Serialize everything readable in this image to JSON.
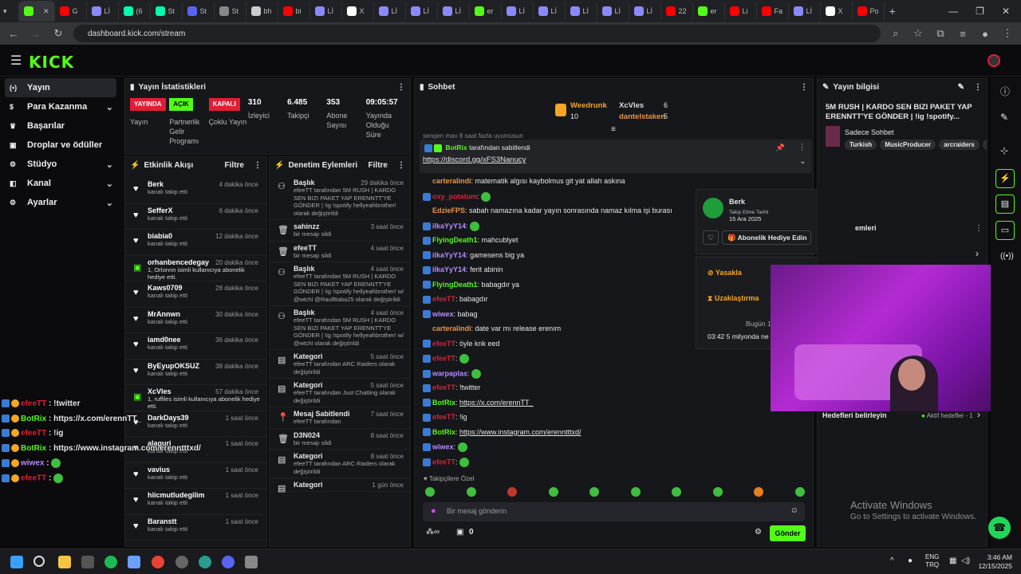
{
  "browser": {
    "tabs": [
      {
        "label": "",
        "color": "#53fc18",
        "active": true
      },
      {
        "label": "G",
        "color": "#ff0000"
      },
      {
        "label": "Lİ",
        "color": "#8a8aff"
      },
      {
        "label": "(6",
        "color": "#0fa"
      },
      {
        "label": "St",
        "color": "#0fa"
      },
      {
        "label": "St",
        "color": "#5865f2"
      },
      {
        "label": "St",
        "color": "#888"
      },
      {
        "label": "bh",
        "color": "#ccc"
      },
      {
        "label": "bi",
        "color": "#ff0000"
      },
      {
        "label": "Lİ",
        "color": "#8a8aff"
      },
      {
        "label": "X",
        "color": "#fff"
      },
      {
        "label": "Lİ",
        "color": "#8a8aff"
      },
      {
        "label": "Lİ",
        "color": "#8a8aff"
      },
      {
        "label": "Lİ",
        "color": "#8a8aff"
      },
      {
        "label": "er",
        "color": "#53fc18"
      },
      {
        "label": "Lİ",
        "color": "#8a8aff"
      },
      {
        "label": "Lİ",
        "color": "#8a8aff"
      },
      {
        "label": "Lİ",
        "color": "#8a8aff"
      },
      {
        "label": "Lİ",
        "color": "#8a8aff"
      },
      {
        "label": "Lİ",
        "color": "#8a8aff"
      },
      {
        "label": "22",
        "color": "#ff0000"
      },
      {
        "label": "er",
        "color": "#53fc18"
      },
      {
        "label": "Li",
        "color": "#ff0000"
      },
      {
        "label": "Fa",
        "color": "#ff0000"
      },
      {
        "label": "Lİ",
        "color": "#8a8aff"
      },
      {
        "label": "X",
        "color": "#fff"
      },
      {
        "label": "Po",
        "color": "#ff0000"
      }
    ],
    "url": "dashboard.kick.com/stream"
  },
  "kick": {
    "logo": "KICK"
  },
  "sidebar": {
    "items": [
      {
        "label": "Yayın",
        "icon": "broadcast-icon",
        "active": true
      },
      {
        "label": "Para Kazanma",
        "icon": "dollar-icon",
        "chev": true
      },
      {
        "label": "Başarılar",
        "icon": "trophy-icon"
      },
      {
        "label": "Droplar ve ödüller",
        "icon": "gift-icon"
      },
      {
        "label": "Stüdyo",
        "icon": "studio-icon",
        "chev": true
      },
      {
        "label": "Kanal",
        "icon": "channel-icon",
        "chev": true
      },
      {
        "label": "Ayarlar",
        "icon": "gear-icon",
        "chev": true
      }
    ]
  },
  "stats": {
    "title": "Yayın İstatistikleri",
    "items": [
      {
        "badge": "YAYINDA",
        "badge_bg": "#e01e37",
        "badge_fg": "#fff",
        "label": "Yayın"
      },
      {
        "badge": "AÇIK",
        "badge_bg": "#53fc18",
        "badge_fg": "#000",
        "label": "Partnerlik Gelir Programı"
      },
      {
        "badge": "KAPALI",
        "badge_bg": "#e01e37",
        "badge_fg": "#fff",
        "label": "Çoklu Yayın"
      },
      {
        "value": "310",
        "label": "İzleyici"
      },
      {
        "value": "6.485",
        "label": "Takipçi"
      },
      {
        "value": "353",
        "label": "Abone Sayısı"
      },
      {
        "value": "09:05:57",
        "label": "Yayında Olduğu Süre"
      }
    ]
  },
  "activity": {
    "title": "Etkinlik Akışı",
    "filter": "Filtre",
    "rows": [
      {
        "name": "Berk",
        "time": "4 dakika önce",
        "sub": "kanalı takip etti",
        "icon": "heart-icon"
      },
      {
        "name": "SefferX",
        "time": "6 dakika önce",
        "sub": "kanalı takip etti",
        "icon": "heart-icon"
      },
      {
        "name": "biabia0",
        "time": "12 dakika önce",
        "sub": "kanalı takip etti",
        "icon": "heart-icon"
      },
      {
        "name": "orhanbencedegay",
        "time": "20 dakika önce",
        "sub": "1, Orİonnn isimli kullanıcıya abonelik hediye etti.",
        "icon": "gift-icon"
      },
      {
        "name": "Kaws0709",
        "time": "28 dakika önce",
        "sub": "kanalı takip etti",
        "icon": "heart-icon"
      },
      {
        "name": "MrAnnwn",
        "time": "30 dakika önce",
        "sub": "kanalı takip etti",
        "icon": "heart-icon"
      },
      {
        "name": "iamd0nee",
        "time": "36 dakika önce",
        "sub": "kanalı takip etti",
        "icon": "heart-icon"
      },
      {
        "name": "ByEyupOKSUZ",
        "time": "38 dakika önce",
        "sub": "kanalı takip etti",
        "icon": "heart-icon"
      },
      {
        "name": "XcVles",
        "time": "57 dakika önce",
        "sub": "1, ruffiles isimli kullanıcıya abonelik hediye etti.",
        "icon": "gift-icon"
      },
      {
        "name": "DarkDays39",
        "time": "1 saat önce",
        "sub": "kanalı takip etti",
        "icon": "heart-icon"
      },
      {
        "name": "alaguri",
        "time": "1 saat önce",
        "sub": "kanalı takip etti",
        "icon": "heart-icon"
      },
      {
        "name": "vavius",
        "time": "1 saat önce",
        "sub": "kanalı takip etti",
        "icon": "heart-icon"
      },
      {
        "name": "hiicmutludegilim",
        "time": "1 saat önce",
        "sub": "kanalı takip etti",
        "icon": "heart-icon"
      },
      {
        "name": "Baranstt",
        "time": "1 saat önce",
        "sub": "kanalı takip etti",
        "icon": "heart-icon"
      }
    ]
  },
  "moderation": {
    "title": "Denetim Eylemleri",
    "filter": "Filtre",
    "rows": [
      {
        "name": "Başlık",
        "time": "29 dakika önce",
        "sub": "efeeTT tarafından 5M RUSH | KARDO SEN BIZI PAKET YAP ERENNTT'YE GÖNDER | !ig !spotify hellyeahbrother! olarak değiştirildi",
        "icon": "users-icon"
      },
      {
        "name": "sahinzz",
        "time": "3 saat önce",
        "sub": "bir mesajı sildi",
        "icon": "trash-icon"
      },
      {
        "name": "efeeTT",
        "time": "4 saat önce",
        "sub": "bir mesajı sildi",
        "icon": "trash-icon"
      },
      {
        "name": "Başlık",
        "time": "4 saat önce",
        "sub": "efeeTT tarafından 5M RUSH | KARDO SEN BIZI PAKET YAP ERENNTT'YE GÖNDER | !ig !spotify hellyeahbrother! w/ @wtcN @RaufBaba25 olarak değiştirildi",
        "icon": "users-icon"
      },
      {
        "name": "Başlık",
        "time": "4 saat önce",
        "sub": "efeeTT tarafından 5M RUSH | KARDO SEN BIZI PAKET YAP ERENNTT'YE GÖNDER | !ig !spotify hellyeahbrother! w/ @wtcN olarak değiştirildi",
        "icon": "users-icon"
      },
      {
        "name": "Kategori",
        "time": "5 saat önce",
        "sub": "efeeTT tarafından ARC Raiders olarak değiştirildi",
        "icon": "category-icon"
      },
      {
        "name": "Kategori",
        "time": "5 saat önce",
        "sub": "efeeTT tarafından Just Chatting olarak değiştirildi",
        "icon": "category-icon"
      },
      {
        "name": "Mesaj Sabitlendi",
        "time": "7 saat önce",
        "sub": "efeeTT tarafından",
        "icon": "pin-icon"
      },
      {
        "name": "D3N024",
        "time": "8 saat önce",
        "sub": "bir mesajı sildi",
        "icon": "trash-icon"
      },
      {
        "name": "Kategori",
        "time": "8 saat önce",
        "sub": "efeeTT tarafından ARC Raiders olarak değiştirildi",
        "icon": "category-icon"
      },
      {
        "name": "Kategori",
        "time": "1 gün önce",
        "sub": "",
        "icon": "category-icon"
      }
    ]
  },
  "chat": {
    "title": "Sohbet",
    "leaders": [
      {
        "name": "Weedrunk",
        "count": "10",
        "color": "#f5a623"
      },
      {
        "name": "XcVles",
        "count": "6",
        "color": "#ddd"
      },
      {
        "name": "dantelstaken",
        "count": "5",
        "color": "#e8954a"
      }
    ],
    "clipped": "sengen max 8 saat fazla uyumusun",
    "pinned": {
      "by": "BotRix",
      "suffix": "tarafından sabitlendi",
      "link": "https://discord.gg/xFS3Nanucy"
    },
    "messages": [
      {
        "user": "carteralindi",
        "color": "#e8954a",
        "text": "matematik algısı kaybolmus git yat allah askına"
      },
      {
        "user": "oxy_potatum",
        "color": "#e01e37",
        "text": ""
      },
      {
        "user": "EdzieFPS",
        "color": "#e8954a",
        "text": "sabah namazına kadar yayın sonrasında namaz kılma işi burası"
      },
      {
        "user": "ilkaYyY14",
        "color": "#b58cff",
        "text": ""
      },
      {
        "user": "FlyingDeath1",
        "color": "#53fc18",
        "text": "mahcublyet"
      },
      {
        "user": "ilkaYyY14",
        "color": "#b58cff",
        "text": "gamesens big ya"
      },
      {
        "user": "ilkaYyY14",
        "color": "#b58cff",
        "text": "ferit abinin"
      },
      {
        "user": "FlyingDeath1",
        "color": "#53fc18",
        "text": "babagdır ya"
      },
      {
        "user": "efeeTT",
        "color": "#e01e37",
        "text": "babagdır"
      },
      {
        "user": "wiwex",
        "color": "#b58cff",
        "text": "babag"
      },
      {
        "user": "carteralindi",
        "color": "#e8954a",
        "text": "date var mı release erenım"
      },
      {
        "user": "efeeTT",
        "color": "#e01e37",
        "text": "öyle knk eed"
      },
      {
        "user": "efeeTT",
        "color": "#e01e37",
        "text": ""
      },
      {
        "user": "warpaplas",
        "color": "#b58cff",
        "text": ""
      },
      {
        "user": "efeeTT",
        "color": "#e01e37",
        "text": "!twitter"
      },
      {
        "user": "BotRix",
        "color": "#53fc18",
        "text": "https://x.com/erennTT_"
      },
      {
        "user": "efeeTT",
        "color": "#e01e37",
        "text": "!ig"
      },
      {
        "user": "BotRix",
        "color": "#53fc18",
        "text": "https://www.instagram.com/erenntttxd/"
      },
      {
        "user": "wiwex",
        "color": "#b58cff",
        "text": ""
      },
      {
        "user": "efeeTT",
        "color": "#e01e37",
        "text": ""
      }
    ],
    "followers_only": "Takipçilere Özel",
    "input_placeholder": "Bir mesaj gönderin",
    "kicks": "0",
    "send": "Gönder"
  },
  "popup": {
    "name": "Berk",
    "follow_label": "Takip Etme Tarihi",
    "follow_date": "15 Ara 2025",
    "gift_btn": "Abonelik Hediye Edin",
    "ban": "Yasakla",
    "timeout": "Uzaklaştırma",
    "today": "Bugün 1",
    "partial": "03:42  5 milyonda ne"
  },
  "streaminfo": {
    "title": "Yayın bilgisi",
    "stream_title": "5M RUSH | KARDO SEN BIZI PAKET YAP ERENNTT'YE GÖNDER | !ig !spotify...",
    "category": "Sadece Sohbet",
    "tags": [
      "Turkish",
      "MusicProducer",
      "arcraiders",
      "cs"
    ],
    "partial_section": "emleri",
    "goals": "Hedefleri belirleyin",
    "active_goals": "Aktif hedefler - 1"
  },
  "overlay": [
    {
      "user": "efeeTT",
      "color": "#e01e37",
      "text": "!twitter"
    },
    {
      "user": "BotRix",
      "color": "#53fc18",
      "text": "https://x.com/erennTT_"
    },
    {
      "user": "efeeTT",
      "color": "#e01e37",
      "text": "!ig"
    },
    {
      "user": "BotRix",
      "color": "#53fc18",
      "text": "https://www.instagram.com/erenntttxd/"
    },
    {
      "user": "wiwex",
      "color": "#b58cff",
      "text": ""
    },
    {
      "user": "efeeTT",
      "color": "#e01e37",
      "text": ""
    }
  ],
  "watermark": {
    "line1": "Activate Windows",
    "line2": "Go to Settings to activate Windows."
  },
  "taskbar": {
    "lang": "ENG",
    "lang2": "TRQ",
    "time": "3:46 AM",
    "date": "12/15/2025"
  }
}
